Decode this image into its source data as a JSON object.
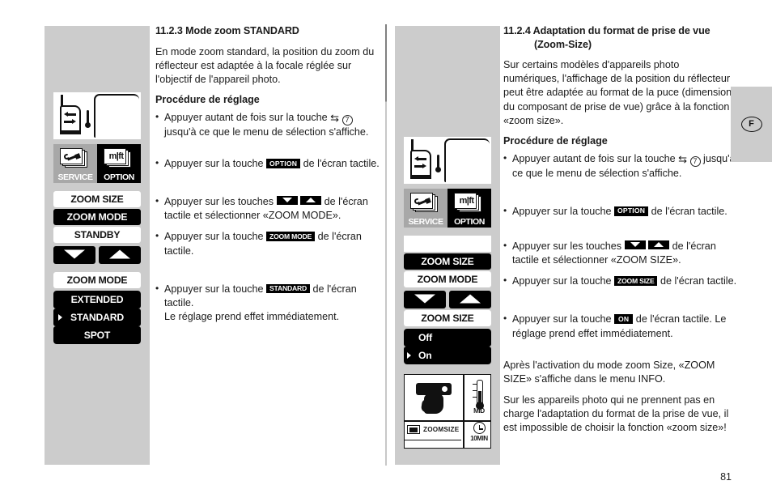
{
  "page": {
    "number": "81",
    "tab_letter": "F"
  },
  "left_column": {
    "section_number": "11.2.3",
    "title": "11.2.3 Mode zoom STANDARD",
    "intro": "En mode zoom standard, la position du zoom du réflecteur est adaptée à la focale réglée sur l'objectif de l'appareil photo.",
    "procedure_heading": "Procédure de réglage",
    "steps": [
      {
        "pre": "Appuyer autant de fois sur la touche ",
        "badge": "",
        "post": " jusqu'à ce que le menu de sélection s'affiche.",
        "key_glyph": "⇆",
        "key_number": "7"
      },
      {
        "pre": "Appuyer sur la touche ",
        "badge": "OPTION",
        "post": " de l'écran tactile."
      },
      {
        "pre": "Appuyer sur les touches ",
        "badge": "",
        "post": " de l'écran tactile et sélectionner «ZOOM MODE»."
      },
      {
        "pre": "Appuyer sur la touche ",
        "badge": "ZOOM MODE",
        "post": " de l'écran tactile."
      },
      {
        "pre": "Appuyer sur la touche ",
        "badge": "STANDARD",
        "post": " de l'écran tactile.",
        "extra": "Le réglage prend effet immédiatement."
      }
    ],
    "menu_screen_1": [
      {
        "label": "ZOOM SIZE",
        "style": "white"
      },
      {
        "label": "ZOOM MODE",
        "style": "black"
      },
      {
        "label": "STANDBY",
        "style": "white"
      }
    ],
    "menu_screen_2_header": {
      "label": "ZOOM MODE",
      "style": "white"
    },
    "menu_screen_2": [
      {
        "label": "EXTENDED",
        "selected": false
      },
      {
        "label": "STANDARD",
        "selected": true
      },
      {
        "label": "SPOT",
        "selected": false
      }
    ],
    "icons": {
      "service_label": "SERVICE",
      "option_label": "OPTION",
      "mft_label": "m|ft"
    }
  },
  "right_column": {
    "section_number": "11.2.4",
    "title_line1": "11.2.4 Adaptation du format de prise de vue",
    "title_line2": "(Zoom-Size)",
    "intro": "Sur certains modèles d'appareils photo numériques, l'affichage de la position du réflecteur peut être adaptée au format de la puce (dimensions du composant de prise de vue) grâce à la fonction «zoom size».",
    "procedure_heading": "Procédure de réglage",
    "steps": [
      {
        "pre": "Appuyer autant de fois sur la touche ",
        "post": " jusqu'à ce que le menu de sélection s'affiche.",
        "key_glyph": "⇆",
        "key_number": "7"
      },
      {
        "pre": "Appuyer sur la touche ",
        "badge": "OPTION",
        "post": " de l'écran tactile."
      },
      {
        "pre": "Appuyer sur les touches ",
        "post": " de l'écran tactile et sélectionner «ZOOM SIZE»."
      },
      {
        "pre": "Appuyer sur la touche ",
        "badge": "ZOOM SIZE",
        "post": " de l'écran tactile."
      },
      {
        "pre": "Appuyer sur la touche ",
        "badge": "ON",
        "post": " de l'écran tactile. Le réglage prend effet immédiatement."
      }
    ],
    "note1": "Après l'activation du mode zoom Size, «ZOOM SIZE» s'affiche dans le menu INFO.",
    "note2": "Sur les appareils photo qui ne prennent pas en charge l'adaptation du format de la prise de vue, il est impossible de choisir la fonction «zoom size»!",
    "menu_screen_1": [
      {
        "label": "",
        "style": "blank"
      },
      {
        "label": "ZOOM SIZE",
        "style": "black"
      },
      {
        "label": "ZOOM MODE",
        "style": "white"
      }
    ],
    "menu_screen_2_header": {
      "label": "ZOOM SIZE",
      "style": "white"
    },
    "menu_screen_2": [
      {
        "label": "Off",
        "selected": false
      },
      {
        "label": "On",
        "selected": true
      }
    ],
    "icons": {
      "service_label": "SERVICE",
      "option_label": "OPTION",
      "mft_label": "m|ft"
    },
    "lcd_info": {
      "zoomsize_label": "ZOOMSIZE",
      "thermo_label": "MID",
      "timer_label": "10MIN"
    }
  }
}
